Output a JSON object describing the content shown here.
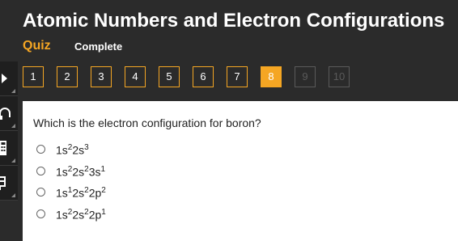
{
  "header": {
    "title": "Atomic Numbers and Electron Configurations",
    "quiz_label": "Quiz",
    "status_label": "Complete"
  },
  "pager": {
    "pages": [
      "1",
      "2",
      "3",
      "4",
      "5",
      "6",
      "7",
      "8",
      "9",
      "10"
    ],
    "current": "8",
    "disabled": [
      "9",
      "10"
    ]
  },
  "question": {
    "text": "Which is the electron configuration for boron?",
    "options": [
      [
        [
          "1s",
          ""
        ],
        [
          "",
          "2"
        ],
        [
          "2s",
          ""
        ],
        [
          "",
          "3"
        ]
      ],
      [
        [
          "1s",
          ""
        ],
        [
          "",
          "2"
        ],
        [
          "2s",
          ""
        ],
        [
          "",
          "2"
        ],
        [
          "3s",
          ""
        ],
        [
          "",
          "1"
        ]
      ],
      [
        [
          "1s",
          ""
        ],
        [
          "",
          "1"
        ],
        [
          "2s",
          ""
        ],
        [
          "",
          "2"
        ],
        [
          "2p",
          ""
        ],
        [
          "",
          "2"
        ]
      ],
      [
        [
          "1s",
          ""
        ],
        [
          "",
          "2"
        ],
        [
          "2s",
          ""
        ],
        [
          "",
          "2"
        ],
        [
          "2p",
          ""
        ],
        [
          "",
          "1"
        ]
      ]
    ]
  },
  "colors": {
    "accent": "#f5a623",
    "background": "#2b2b2b",
    "panel": "#ffffff"
  },
  "side_rail_icons": [
    "arrow-icon",
    "headphones-icon",
    "calculator-icon",
    "reference-icon"
  ]
}
